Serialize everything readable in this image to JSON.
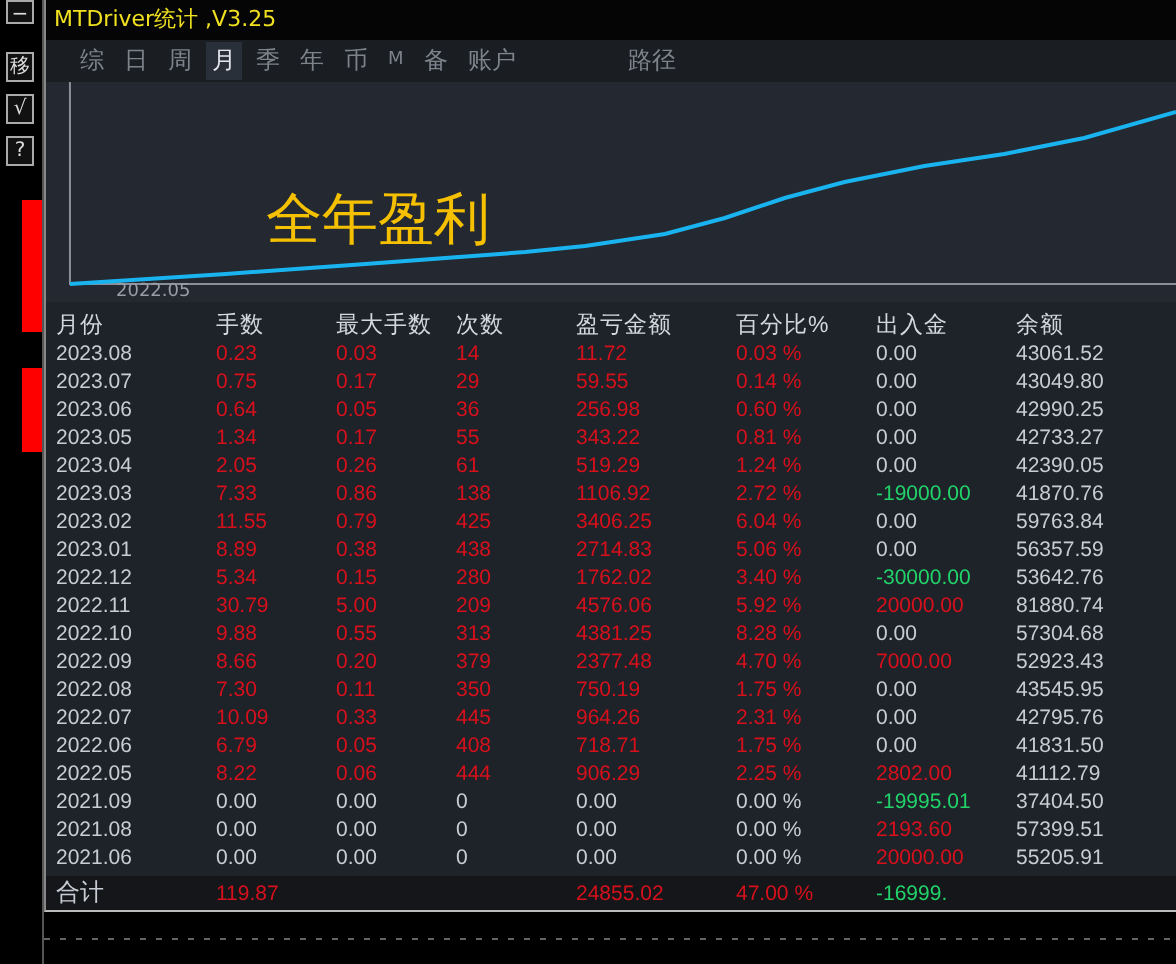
{
  "window": {
    "title": "MTDriver统计 ,V3.25"
  },
  "side_buttons": [
    "−",
    "移",
    "√",
    "?"
  ],
  "tabs": [
    {
      "label": "综",
      "selected": false
    },
    {
      "label": "日",
      "selected": false
    },
    {
      "label": "周",
      "selected": false
    },
    {
      "label": "月",
      "selected": true
    },
    {
      "label": "季",
      "selected": false
    },
    {
      "label": "年",
      "selected": false
    },
    {
      "label": "币",
      "selected": false
    },
    {
      "label": "M",
      "selected": false
    },
    {
      "label": "备",
      "selected": false
    },
    {
      "label": "账户",
      "selected": false
    }
  ],
  "path_tab": {
    "label": "路径",
    "selected": false
  },
  "chart": {
    "overlay_text": "全年盈利",
    "x_label": "2022.05"
  },
  "table": {
    "columns": [
      "月份",
      "手数",
      "最大手数",
      "次数",
      "盈亏金额",
      "百分比%",
      "出入金",
      "余额"
    ],
    "rows": [
      [
        {
          "text": "2023.08",
          "color": "#c8ccd4"
        },
        {
          "text": "0.23",
          "color": "#d8101c"
        },
        {
          "text": "0.03",
          "color": "#d8101c"
        },
        {
          "text": "14",
          "color": "#d8101c"
        },
        {
          "text": "11.72",
          "color": "#d8101c"
        },
        {
          "text": "0.03 %",
          "color": "#d8101c"
        },
        {
          "text": "0.00",
          "color": "#c8ccd4"
        },
        {
          "text": "43061.52",
          "color": "#c8ccd4"
        }
      ],
      [
        {
          "text": "2023.07",
          "color": "#c8ccd4"
        },
        {
          "text": "0.75",
          "color": "#d8101c"
        },
        {
          "text": "0.17",
          "color": "#d8101c"
        },
        {
          "text": "29",
          "color": "#d8101c"
        },
        {
          "text": "59.55",
          "color": "#d8101c"
        },
        {
          "text": "0.14 %",
          "color": "#d8101c"
        },
        {
          "text": "0.00",
          "color": "#c8ccd4"
        },
        {
          "text": "43049.80",
          "color": "#c8ccd4"
        }
      ],
      [
        {
          "text": "2023.06",
          "color": "#c8ccd4"
        },
        {
          "text": "0.64",
          "color": "#d8101c"
        },
        {
          "text": "0.05",
          "color": "#d8101c"
        },
        {
          "text": "36",
          "color": "#d8101c"
        },
        {
          "text": "256.98",
          "color": "#d8101c"
        },
        {
          "text": "0.60 %",
          "color": "#d8101c"
        },
        {
          "text": "0.00",
          "color": "#c8ccd4"
        },
        {
          "text": "42990.25",
          "color": "#c8ccd4"
        }
      ],
      [
        {
          "text": "2023.05",
          "color": "#c8ccd4"
        },
        {
          "text": "1.34",
          "color": "#d8101c"
        },
        {
          "text": "0.17",
          "color": "#d8101c"
        },
        {
          "text": "55",
          "color": "#d8101c"
        },
        {
          "text": "343.22",
          "color": "#d8101c"
        },
        {
          "text": "0.81 %",
          "color": "#d8101c"
        },
        {
          "text": "0.00",
          "color": "#c8ccd4"
        },
        {
          "text": "42733.27",
          "color": "#c8ccd4"
        }
      ],
      [
        {
          "text": "2023.04",
          "color": "#c8ccd4"
        },
        {
          "text": "2.05",
          "color": "#d8101c"
        },
        {
          "text": "0.26",
          "color": "#d8101c"
        },
        {
          "text": "61",
          "color": "#d8101c"
        },
        {
          "text": "519.29",
          "color": "#d8101c"
        },
        {
          "text": "1.24 %",
          "color": "#d8101c"
        },
        {
          "text": "0.00",
          "color": "#c8ccd4"
        },
        {
          "text": "42390.05",
          "color": "#c8ccd4"
        }
      ],
      [
        {
          "text": "2023.03",
          "color": "#c8ccd4"
        },
        {
          "text": "7.33",
          "color": "#d8101c"
        },
        {
          "text": "0.86",
          "color": "#d8101c"
        },
        {
          "text": "138",
          "color": "#d8101c"
        },
        {
          "text": "1106.92",
          "color": "#d8101c"
        },
        {
          "text": "2.72 %",
          "color": "#d8101c"
        },
        {
          "text": "-19000.00",
          "color": "#22d36a"
        },
        {
          "text": "41870.76",
          "color": "#c8ccd4"
        }
      ],
      [
        {
          "text": "2023.02",
          "color": "#c8ccd4"
        },
        {
          "text": "11.55",
          "color": "#d8101c"
        },
        {
          "text": "0.79",
          "color": "#d8101c"
        },
        {
          "text": "425",
          "color": "#d8101c"
        },
        {
          "text": "3406.25",
          "color": "#d8101c"
        },
        {
          "text": "6.04 %",
          "color": "#d8101c"
        },
        {
          "text": "0.00",
          "color": "#c8ccd4"
        },
        {
          "text": "59763.84",
          "color": "#c8ccd4"
        }
      ],
      [
        {
          "text": "2023.01",
          "color": "#c8ccd4"
        },
        {
          "text": "8.89",
          "color": "#d8101c"
        },
        {
          "text": "0.38",
          "color": "#d8101c"
        },
        {
          "text": "438",
          "color": "#d8101c"
        },
        {
          "text": "2714.83",
          "color": "#d8101c"
        },
        {
          "text": "5.06 %",
          "color": "#d8101c"
        },
        {
          "text": "0.00",
          "color": "#c8ccd4"
        },
        {
          "text": "56357.59",
          "color": "#c8ccd4"
        }
      ],
      [
        {
          "text": "2022.12",
          "color": "#c8ccd4"
        },
        {
          "text": "5.34",
          "color": "#d8101c"
        },
        {
          "text": "0.15",
          "color": "#d8101c"
        },
        {
          "text": "280",
          "color": "#d8101c"
        },
        {
          "text": "1762.02",
          "color": "#d8101c"
        },
        {
          "text": "3.40 %",
          "color": "#d8101c"
        },
        {
          "text": "-30000.00",
          "color": "#22d36a"
        },
        {
          "text": "53642.76",
          "color": "#c8ccd4"
        }
      ],
      [
        {
          "text": "2022.11",
          "color": "#c8ccd4"
        },
        {
          "text": "30.79",
          "color": "#d8101c"
        },
        {
          "text": "5.00",
          "color": "#d8101c"
        },
        {
          "text": "209",
          "color": "#d8101c"
        },
        {
          "text": "4576.06",
          "color": "#d8101c"
        },
        {
          "text": "5.92 %",
          "color": "#d8101c"
        },
        {
          "text": "20000.00",
          "color": "#d8101c"
        },
        {
          "text": "81880.74",
          "color": "#c8ccd4"
        }
      ],
      [
        {
          "text": "2022.10",
          "color": "#c8ccd4"
        },
        {
          "text": "9.88",
          "color": "#d8101c"
        },
        {
          "text": "0.55",
          "color": "#d8101c"
        },
        {
          "text": "313",
          "color": "#d8101c"
        },
        {
          "text": "4381.25",
          "color": "#d8101c"
        },
        {
          "text": "8.28 %",
          "color": "#d8101c"
        },
        {
          "text": "0.00",
          "color": "#c8ccd4"
        },
        {
          "text": "57304.68",
          "color": "#c8ccd4"
        }
      ],
      [
        {
          "text": "2022.09",
          "color": "#c8ccd4"
        },
        {
          "text": "8.66",
          "color": "#d8101c"
        },
        {
          "text": "0.20",
          "color": "#d8101c"
        },
        {
          "text": "379",
          "color": "#d8101c"
        },
        {
          "text": "2377.48",
          "color": "#d8101c"
        },
        {
          "text": "4.70 %",
          "color": "#d8101c"
        },
        {
          "text": "7000.00",
          "color": "#d8101c"
        },
        {
          "text": "52923.43",
          "color": "#c8ccd4"
        }
      ],
      [
        {
          "text": "2022.08",
          "color": "#c8ccd4"
        },
        {
          "text": "7.30",
          "color": "#d8101c"
        },
        {
          "text": "0.11",
          "color": "#d8101c"
        },
        {
          "text": "350",
          "color": "#d8101c"
        },
        {
          "text": "750.19",
          "color": "#d8101c"
        },
        {
          "text": "1.75 %",
          "color": "#d8101c"
        },
        {
          "text": "0.00",
          "color": "#c8ccd4"
        },
        {
          "text": "43545.95",
          "color": "#c8ccd4"
        }
      ],
      [
        {
          "text": "2022.07",
          "color": "#c8ccd4"
        },
        {
          "text": "10.09",
          "color": "#d8101c"
        },
        {
          "text": "0.33",
          "color": "#d8101c"
        },
        {
          "text": "445",
          "color": "#d8101c"
        },
        {
          "text": "964.26",
          "color": "#d8101c"
        },
        {
          "text": "2.31 %",
          "color": "#d8101c"
        },
        {
          "text": "0.00",
          "color": "#c8ccd4"
        },
        {
          "text": "42795.76",
          "color": "#c8ccd4"
        }
      ],
      [
        {
          "text": "2022.06",
          "color": "#c8ccd4"
        },
        {
          "text": "6.79",
          "color": "#d8101c"
        },
        {
          "text": "0.05",
          "color": "#d8101c"
        },
        {
          "text": "408",
          "color": "#d8101c"
        },
        {
          "text": "718.71",
          "color": "#d8101c"
        },
        {
          "text": "1.75 %",
          "color": "#d8101c"
        },
        {
          "text": "0.00",
          "color": "#c8ccd4"
        },
        {
          "text": "41831.50",
          "color": "#c8ccd4"
        }
      ],
      [
        {
          "text": "2022.05",
          "color": "#c8ccd4"
        },
        {
          "text": "8.22",
          "color": "#d8101c"
        },
        {
          "text": "0.06",
          "color": "#d8101c"
        },
        {
          "text": "444",
          "color": "#d8101c"
        },
        {
          "text": "906.29",
          "color": "#d8101c"
        },
        {
          "text": "2.25 %",
          "color": "#d8101c"
        },
        {
          "text": "2802.00",
          "color": "#d8101c"
        },
        {
          "text": "41112.79",
          "color": "#c8ccd4"
        }
      ],
      [
        {
          "text": "2021.09",
          "color": "#c8ccd4"
        },
        {
          "text": "0.00",
          "color": "#c8ccd4"
        },
        {
          "text": "0.00",
          "color": "#c8ccd4"
        },
        {
          "text": "0",
          "color": "#c8ccd4"
        },
        {
          "text": "0.00",
          "color": "#c8ccd4"
        },
        {
          "text": "0.00 %",
          "color": "#c8ccd4"
        },
        {
          "text": "-19995.01",
          "color": "#22d36a"
        },
        {
          "text": "37404.50",
          "color": "#c8ccd4"
        }
      ],
      [
        {
          "text": "2021.08",
          "color": "#c8ccd4"
        },
        {
          "text": "0.00",
          "color": "#c8ccd4"
        },
        {
          "text": "0.00",
          "color": "#c8ccd4"
        },
        {
          "text": "0",
          "color": "#c8ccd4"
        },
        {
          "text": "0.00",
          "color": "#c8ccd4"
        },
        {
          "text": "0.00 %",
          "color": "#c8ccd4"
        },
        {
          "text": "2193.60",
          "color": "#d8101c"
        },
        {
          "text": "57399.51",
          "color": "#c8ccd4"
        }
      ],
      [
        {
          "text": "2021.06",
          "color": "#c8ccd4"
        },
        {
          "text": "0.00",
          "color": "#c8ccd4"
        },
        {
          "text": "0.00",
          "color": "#c8ccd4"
        },
        {
          "text": "0",
          "color": "#c8ccd4"
        },
        {
          "text": "0.00",
          "color": "#c8ccd4"
        },
        {
          "text": "0.00 %",
          "color": "#c8ccd4"
        },
        {
          "text": "20000.00",
          "color": "#d8101c"
        },
        {
          "text": "55205.91",
          "color": "#c8ccd4"
        }
      ]
    ],
    "total": {
      "label": {
        "text": "合计",
        "color": "#c8ccd4"
      },
      "lots": {
        "text": "119.87",
        "color": "#d8101c"
      },
      "pnl": {
        "text": "24855.02",
        "color": "#d8101c"
      },
      "percent": {
        "text": "47.00 %",
        "color": "#d8101c"
      },
      "deposit": {
        "text": "-16999.",
        "color": "#22d36a"
      }
    }
  }
}
